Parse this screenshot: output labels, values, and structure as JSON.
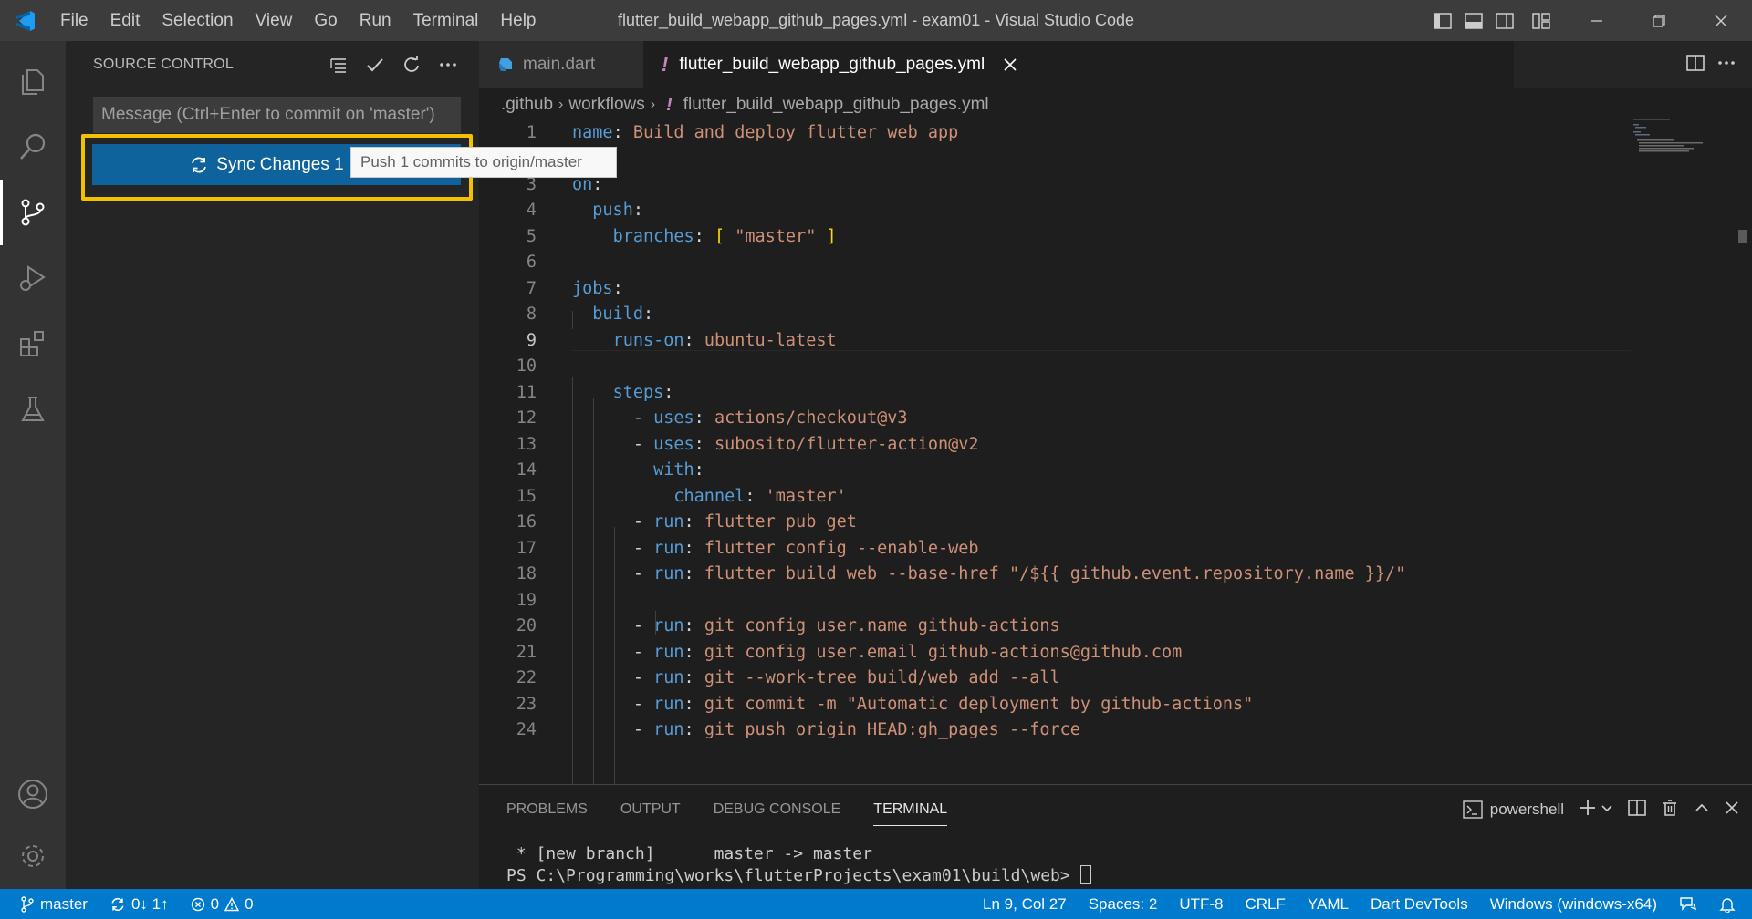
{
  "window": {
    "title": "flutter_build_webapp_github_pages.yml - exam01 - Visual Studio Code",
    "menu": [
      "File",
      "Edit",
      "Selection",
      "View",
      "Go",
      "Run",
      "Terminal",
      "Help"
    ]
  },
  "sidebar": {
    "title": "SOURCE CONTROL",
    "commit_placeholder": "Message (Ctrl+Enter to commit on 'master')",
    "sync_button": "Sync Changes 1",
    "sync_tooltip": "Push 1 commits to origin/master"
  },
  "tabs": [
    {
      "label": "main.dart",
      "icon": "dart-icon"
    },
    {
      "label": "flutter_build_webapp_github_pages.yml",
      "icon": "yaml-exclamation-icon"
    }
  ],
  "breadcrumb": [
    ".github",
    "workflows",
    "flutter_build_webapp_github_pages.yml"
  ],
  "editor": {
    "current_line": 9,
    "lines": [
      {
        "n": "1"
      },
      {
        "n": "2"
      },
      {
        "n": "3"
      },
      {
        "n": "4"
      },
      {
        "n": "5"
      },
      {
        "n": "6"
      },
      {
        "n": "7"
      },
      {
        "n": "8"
      },
      {
        "n": "9"
      },
      {
        "n": "10"
      },
      {
        "n": "11"
      },
      {
        "n": "12"
      },
      {
        "n": "13"
      },
      {
        "n": "14"
      },
      {
        "n": "15"
      },
      {
        "n": "16"
      },
      {
        "n": "17"
      },
      {
        "n": "18"
      },
      {
        "n": "19"
      },
      {
        "n": "20"
      },
      {
        "n": "21"
      },
      {
        "n": "22"
      },
      {
        "n": "23"
      },
      {
        "n": "24"
      }
    ],
    "code": {
      "l1": {
        "key": "name",
        "val": "Build and deploy flutter web app"
      },
      "l3": {
        "key": "on"
      },
      "l4": {
        "key": "push"
      },
      "l5": {
        "key": "branches",
        "open": "[",
        "val": "\"master\"",
        "close": "]"
      },
      "l7": {
        "key": "jobs"
      },
      "l8": {
        "key": "build"
      },
      "l9": {
        "key": "runs-on",
        "val": "ubuntu-latest"
      },
      "l11": {
        "key": "steps"
      },
      "l12": {
        "key": "uses",
        "val": "actions/checkout@v3"
      },
      "l13": {
        "key": "uses",
        "val": "subosito/flutter-action@v2"
      },
      "l14": {
        "key": "with"
      },
      "l15": {
        "key": "channel",
        "val": "'master'"
      },
      "l16": {
        "key": "run",
        "val": "flutter pub get"
      },
      "l17": {
        "key": "run",
        "val": "flutter config --enable-web"
      },
      "l18": {
        "key": "run",
        "val": "flutter build web --base-href \"/${{ github.event.repository.name }}/\""
      },
      "l20": {
        "key": "run",
        "val": "git config user.name github-actions"
      },
      "l21": {
        "key": "run",
        "val": "git config user.email github-actions@github.com"
      },
      "l22": {
        "key": "run",
        "val": "git --work-tree build/web add --all"
      },
      "l23": {
        "key": "run",
        "val": "git commit -m \"Automatic deployment by github-actions\""
      },
      "l24": {
        "key": "run",
        "val": "git push origin HEAD:gh_pages --force"
      }
    }
  },
  "panel": {
    "tabs": [
      "PROBLEMS",
      "OUTPUT",
      "DEBUG CONSOLE",
      "TERMINAL"
    ],
    "active_tab": "TERMINAL",
    "shell": "powershell",
    "terminal_lines": [
      " * [new branch]      master -> master",
      "PS C:\\Programming\\works\\flutterProjects\\exam01\\build\\web> "
    ]
  },
  "statusbar": {
    "branch": "master",
    "sync": "0↓ 1↑",
    "errors": "0",
    "warnings": "0",
    "position": "Ln 9, Col 27",
    "spaces": "Spaces: 2",
    "encoding": "UTF-8",
    "eol": "CRLF",
    "language": "YAML",
    "devtools": "Dart DevTools",
    "platform": "Windows (windows-x64)"
  },
  "colors": {
    "accent": "#007acc",
    "button": "#0e639c",
    "highlight": "#f2c200",
    "keyword": "#569cd6",
    "string": "#ce9178"
  }
}
